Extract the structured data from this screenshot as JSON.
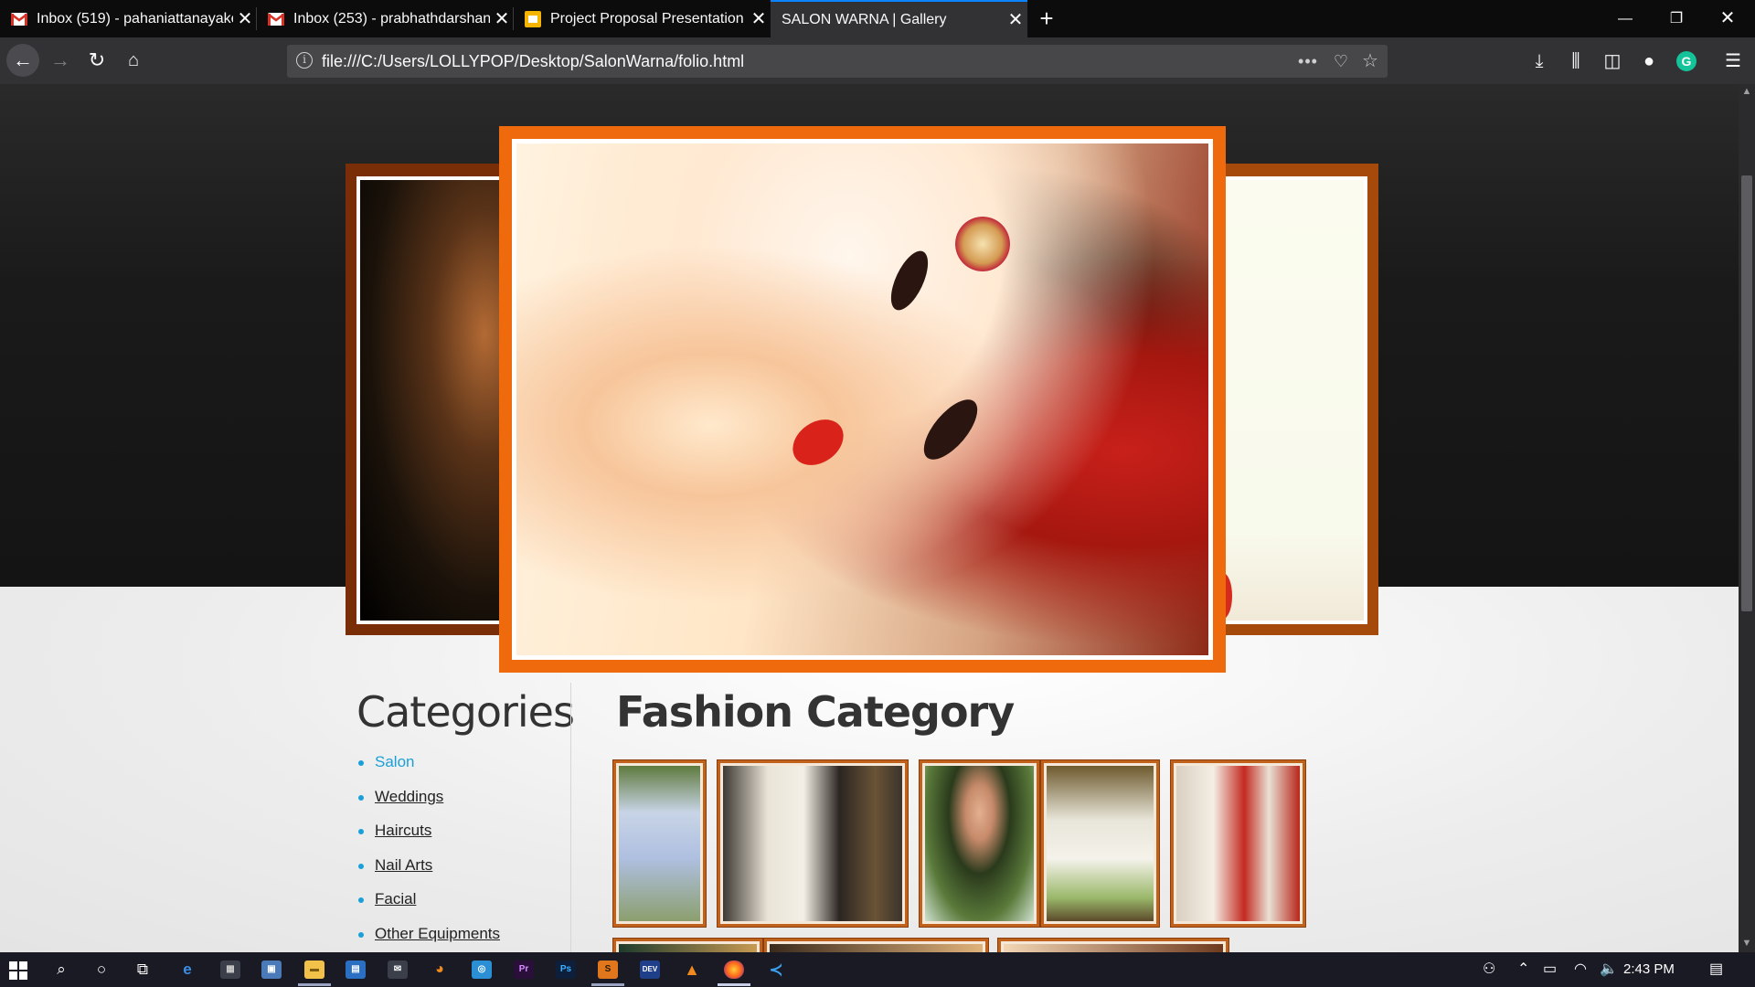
{
  "browser": {
    "tabs": [
      {
        "title": "Inbox (519) - pahaniattanayake",
        "icon": "gmail-icon"
      },
      {
        "title": "Inbox (253) - prabhathdarshana",
        "icon": "gmail-icon"
      },
      {
        "title": "Project Proposal Presentation -",
        "icon": "slides-icon"
      },
      {
        "title": "SALON WARNA | Gallery",
        "icon": "none"
      }
    ],
    "active_tab": 3,
    "url": "file:///C:/Users/LOLLYPOP/Desktop/SalonWarna/folio.html",
    "colors": {
      "accent": "#0a84ff",
      "chrome": "#323234",
      "tabbar": "#0c0c0d"
    }
  },
  "page": {
    "sidebar": {
      "title": "Categories",
      "items": [
        {
          "label": "Salon",
          "active": true
        },
        {
          "label": "Weddings",
          "active": false
        },
        {
          "label": "Haircuts",
          "active": false
        },
        {
          "label": "Nail Arts",
          "active": false
        },
        {
          "label": "Facial",
          "active": false
        },
        {
          "label": "Other Equipments",
          "active": false
        }
      ]
    },
    "main": {
      "title": "Fashion Category"
    },
    "colors": {
      "link_active": "#1aa0d9",
      "frame_orange": "#ee6a0d",
      "frame_dark": "#7a2e08"
    }
  },
  "taskbar": {
    "time": "2:43 PM"
  }
}
